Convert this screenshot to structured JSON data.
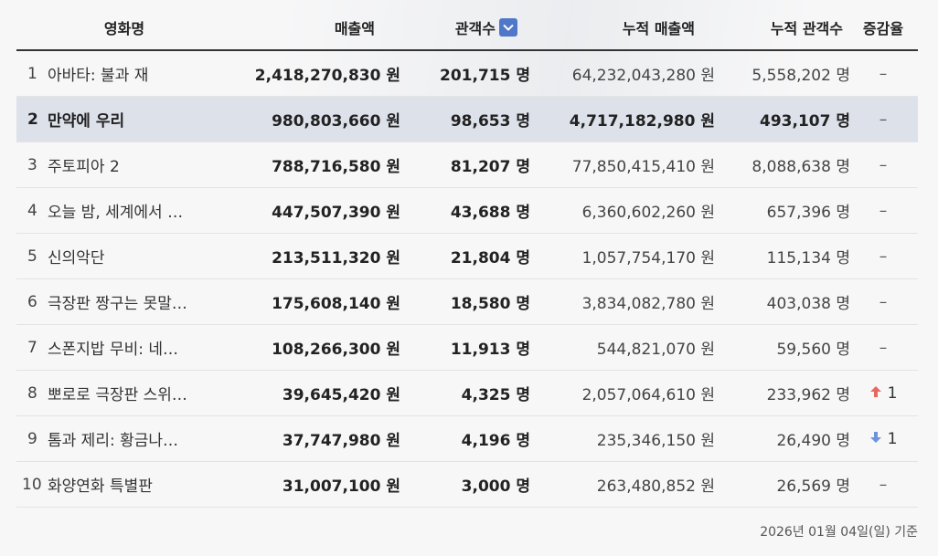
{
  "header": {
    "title": "영화명",
    "sales": "매출액",
    "audience": "관객수",
    "cum_sales": "누적 매출액",
    "cum_audience": "누적 관객수",
    "change": "증감율"
  },
  "sort_icon": "chevron-down-icon",
  "colors": {
    "highlight": "#dde1ea",
    "sort_button": "#4f78c8",
    "up": "#e8685f",
    "down": "#6c93dc"
  },
  "rows": [
    {
      "rank": "1",
      "title": "아바타: 불과 재",
      "sales": "2,418,270,830 원",
      "audience": "201,715 명",
      "cum_sales": "64,232,043,280 원",
      "cum_audience": "5,558,202 명",
      "change": "–",
      "direction": "none"
    },
    {
      "rank": "2",
      "title": "만약에 우리",
      "sales": "980,803,660 원",
      "audience": "98,653 명",
      "cum_sales": "4,717,182,980 원",
      "cum_audience": "493,107 명",
      "change": "–",
      "direction": "none"
    },
    {
      "rank": "3",
      "title": "주토피아 2",
      "sales": "788,716,580 원",
      "audience": "81,207 명",
      "cum_sales": "77,850,415,410 원",
      "cum_audience": "8,088,638 명",
      "change": "–",
      "direction": "none"
    },
    {
      "rank": "4",
      "title": "오늘 밤, 세계에서 …",
      "sales": "447,507,390 원",
      "audience": "43,688 명",
      "cum_sales": "6,360,602,260 원",
      "cum_audience": "657,396 명",
      "change": "–",
      "direction": "none"
    },
    {
      "rank": "5",
      "title": "신의악단",
      "sales": "213,511,320 원",
      "audience": "21,804 명",
      "cum_sales": "1,057,754,170 원",
      "cum_audience": "115,134 명",
      "change": "–",
      "direction": "none"
    },
    {
      "rank": "6",
      "title": "극장판 짱구는 못말…",
      "sales": "175,608,140 원",
      "audience": "18,580 명",
      "cum_sales": "3,834,082,780 원",
      "cum_audience": "403,038 명",
      "change": "–",
      "direction": "none"
    },
    {
      "rank": "7",
      "title": "스폰지밥 무비: 네…",
      "sales": "108,266,300 원",
      "audience": "11,913 명",
      "cum_sales": "544,821,070 원",
      "cum_audience": "59,560 명",
      "change": "–",
      "direction": "none"
    },
    {
      "rank": "8",
      "title": "뽀로로 극장판 스위…",
      "sales": "39,645,420 원",
      "audience": "4,325 명",
      "cum_sales": "2,057,064,610 원",
      "cum_audience": "233,962 명",
      "change": "1",
      "direction": "up"
    },
    {
      "rank": "9",
      "title": "톰과 제리: 황금나…",
      "sales": "37,747,980 원",
      "audience": "4,196 명",
      "cum_sales": "235,346,150 원",
      "cum_audience": "26,490 명",
      "change": "1",
      "direction": "down"
    },
    {
      "rank": "10",
      "title": "화양연화 특별판",
      "sales": "31,007,100 원",
      "audience": "3,000 명",
      "cum_sales": "263,480,852 원",
      "cum_audience": "26,569 명",
      "change": "–",
      "direction": "none"
    }
  ],
  "footer": "2026년 01월 04일(일) 기준"
}
